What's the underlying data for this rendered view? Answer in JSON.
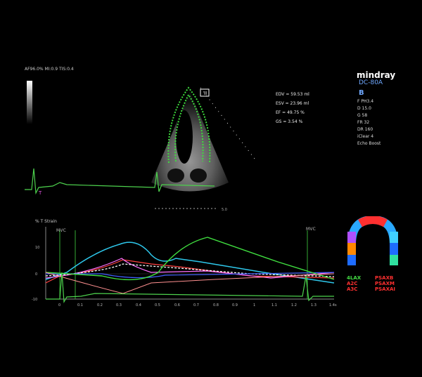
{
  "header": {
    "info": "AF96.0% MI:0.9 TIS:0.4"
  },
  "brand": {
    "name": "mindray",
    "model": "DC-80A",
    "mode": "B"
  },
  "params": [
    "F PH3.4",
    "D 15.0",
    "G 58",
    "FR 32",
    "DR 160",
    "iClear 4",
    "Echo Boost"
  ],
  "measurements": {
    "edv": "EDV = 59.53 ml",
    "esv": "ESV = 23.96 ml",
    "ef": "EF = 49.75 %",
    "gs": "GS = 3.54 %"
  },
  "graph": {
    "title": "% T Strain",
    "mvc_left": "MVC",
    "mvc_right": "MVC",
    "y_ticks": [
      "10",
      "0",
      "-10"
    ],
    "x_ticks": [
      "0",
      "0.1",
      "0.2",
      "0.3",
      "0.4",
      "0.5",
      "0.6",
      "0.7",
      "0.8",
      "0.9",
      "1",
      "1.1",
      "1.2",
      "1.3",
      "1.4s"
    ]
  },
  "segments": {
    "left": [
      "4LAX",
      "A2C",
      "A3C"
    ],
    "right": [
      "PSAXB",
      "PSAXM",
      "PSAXAI"
    ],
    "colors": {
      "left": "#44dd44",
      "right": "#ff3030",
      "a2c": "#ff3030",
      "a3c": "#ff3030"
    }
  },
  "image_icon": "heart-ultrasound-image",
  "depth_marker": "5.0"
}
